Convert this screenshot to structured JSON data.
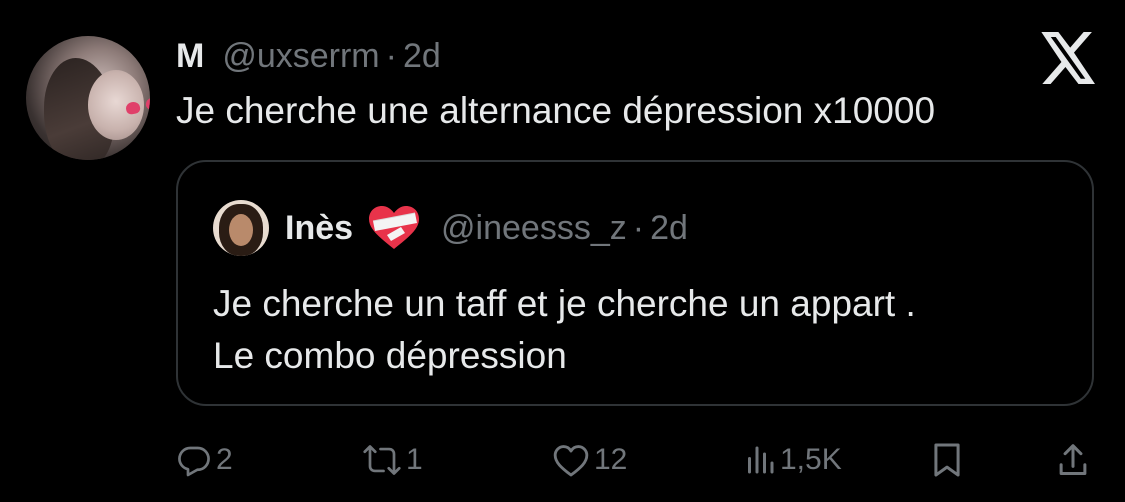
{
  "tweet": {
    "author_name": "M",
    "handle": "@uxserrm",
    "separator": "·",
    "time": "2d",
    "text": "Je cherche une alternance dépression x10000"
  },
  "quoted_tweet": {
    "author_name": "Inès",
    "handle": "@ineesss_z",
    "separator": "·",
    "time": "2d",
    "text_line1": "Je cherche un taff et je cherche un appart .",
    "text_line2": "Le combo dépression"
  },
  "actions": {
    "replies": "2",
    "reposts": "1",
    "likes": "12",
    "views": "1,5K"
  },
  "icons": {
    "logo": "x-logo-icon",
    "reply": "reply-icon",
    "repost": "repost-icon",
    "like": "heart-icon",
    "views": "views-icon",
    "bookmark": "bookmark-icon",
    "share": "share-icon",
    "emoji": "mending-heart-emoji"
  },
  "colors": {
    "background": "#000000",
    "text": "#e7e9ea",
    "secondary": "#71767b",
    "border": "#2f3336"
  }
}
